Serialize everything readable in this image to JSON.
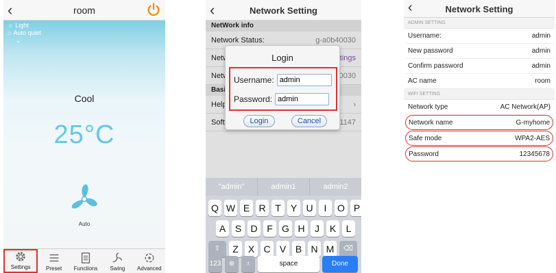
{
  "screen1": {
    "title": "room",
    "status_light": "Light",
    "status_quiet": "Auto quiet",
    "mode": "Cool",
    "temperature": "25°C",
    "fan_label": "Auto",
    "tabs": [
      "Settings",
      "Preset",
      "Functions",
      "Swing",
      "Advanced"
    ],
    "accent_color": "#f08a00",
    "highlight_color": "#e03030"
  },
  "screen2": {
    "title": "Network Setting",
    "section_network": "NetWork info",
    "network_status_label": "Network Status:",
    "network_status_value": "g-a0b40030",
    "row2_label": "Netw",
    "row2_value": "ttings",
    "row3_label": "Netw",
    "row3_value": "40030",
    "section_basic": "Basic",
    "help_label": "Help",
    "software_label": "Softw",
    "software_value": "1147",
    "dialog": {
      "title": "Login",
      "username_label": "Username:",
      "username_value": "admin",
      "password_label": "Password:",
      "password_value": "admin",
      "login_button": "Login",
      "cancel_button": "Cancel"
    },
    "suggestions": [
      "\"admin\"",
      "admin1",
      "admin2"
    ],
    "keys_row1": [
      "Q",
      "W",
      "E",
      "R",
      "T",
      "Y",
      "U",
      "I",
      "O",
      "P"
    ],
    "keys_row2": [
      "A",
      "S",
      "D",
      "F",
      "G",
      "H",
      "J",
      "K",
      "L"
    ],
    "keys_row3": [
      "Z",
      "X",
      "C",
      "V",
      "B",
      "N",
      "M"
    ],
    "key_123": "123",
    "key_space": "space",
    "key_done": "Done"
  },
  "screen3": {
    "title": "Network Setting",
    "admin_section": "ADMIN SETTING",
    "admin_rows": [
      {
        "label": "Username:",
        "value": "admin"
      },
      {
        "label": "New password",
        "value": "admin"
      },
      {
        "label": "Confirm password",
        "value": "admin"
      },
      {
        "label": "AC name",
        "value": "room"
      }
    ],
    "wifi_section": "WIFI SETTING",
    "network_type_label": "Network type",
    "network_type_value": "AC Network(AP)",
    "network_name_label": "Network name",
    "network_name_value": "G-myhome",
    "safe_mode_label": "Safe mode",
    "safe_mode_value": "WPA2-AES",
    "password_label": "Password",
    "password_value": "12345678"
  }
}
